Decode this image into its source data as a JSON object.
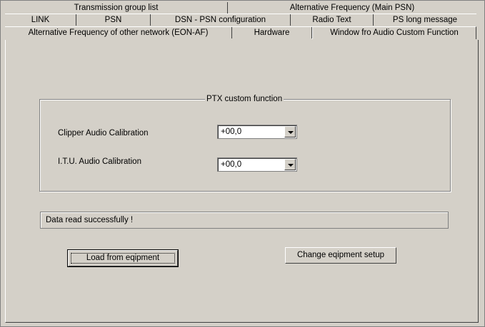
{
  "tabs": {
    "row_top": [
      "Transmission group list",
      "Alternative Frequency (Main PSN)"
    ],
    "row_mid": [
      "LINK",
      "PSN",
      "DSN - PSN configuration",
      "Radio Text",
      "PS long message"
    ],
    "row_bot": [
      "Alternative Frequency of other network (EON-AF)",
      "Hardware",
      "Window fro Audio Custom Function"
    ],
    "active": "Window fro Audio Custom Function"
  },
  "group": {
    "title": "PTX  custom function",
    "clipper_label": "Clipper Audio Calibration",
    "clipper_value": "+00,0",
    "itu_label": "I.T.U.  Audio Calibration",
    "itu_value": "+00,0"
  },
  "status": {
    "text": "Data read successfully !"
  },
  "buttons": {
    "load": "Load from eqipment",
    "change": "Change eqipment setup"
  }
}
